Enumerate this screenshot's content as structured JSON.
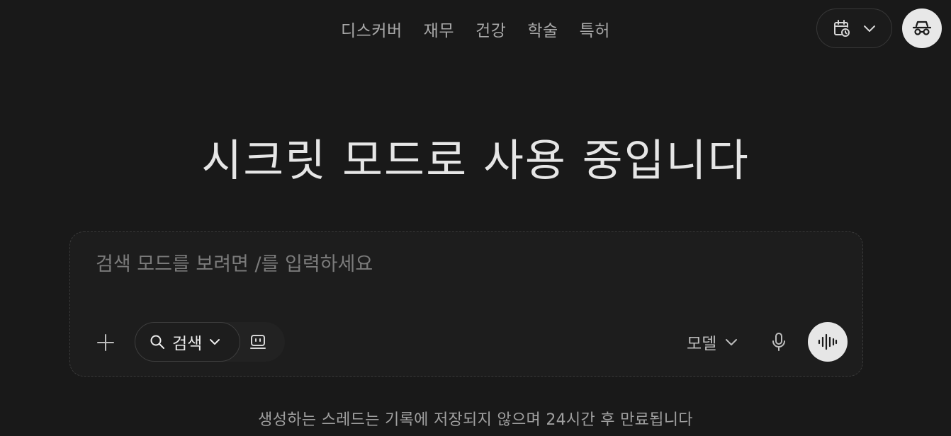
{
  "nav": {
    "items": [
      {
        "label": "디스커버"
      },
      {
        "label": "재무"
      },
      {
        "label": "건강"
      },
      {
        "label": "학술"
      },
      {
        "label": "특허"
      }
    ]
  },
  "top_right": {
    "history_icon": "calendar-clock-icon",
    "incognito_icon": "incognito-icon"
  },
  "headline": "시크릿 모드로 사용 중입니다",
  "composer": {
    "placeholder": "검색 모드를 보려면 /를 입력하세요",
    "mode_label": "검색",
    "model_label": "모델"
  },
  "footer_note": "생성하는 스레드는 기록에 저장되지 않으며 24시간 후 만료됩니다",
  "colors": {
    "background": "#191919",
    "composer_bg": "#1d1d1d",
    "voice_button_bg": "#e6e6e6"
  }
}
